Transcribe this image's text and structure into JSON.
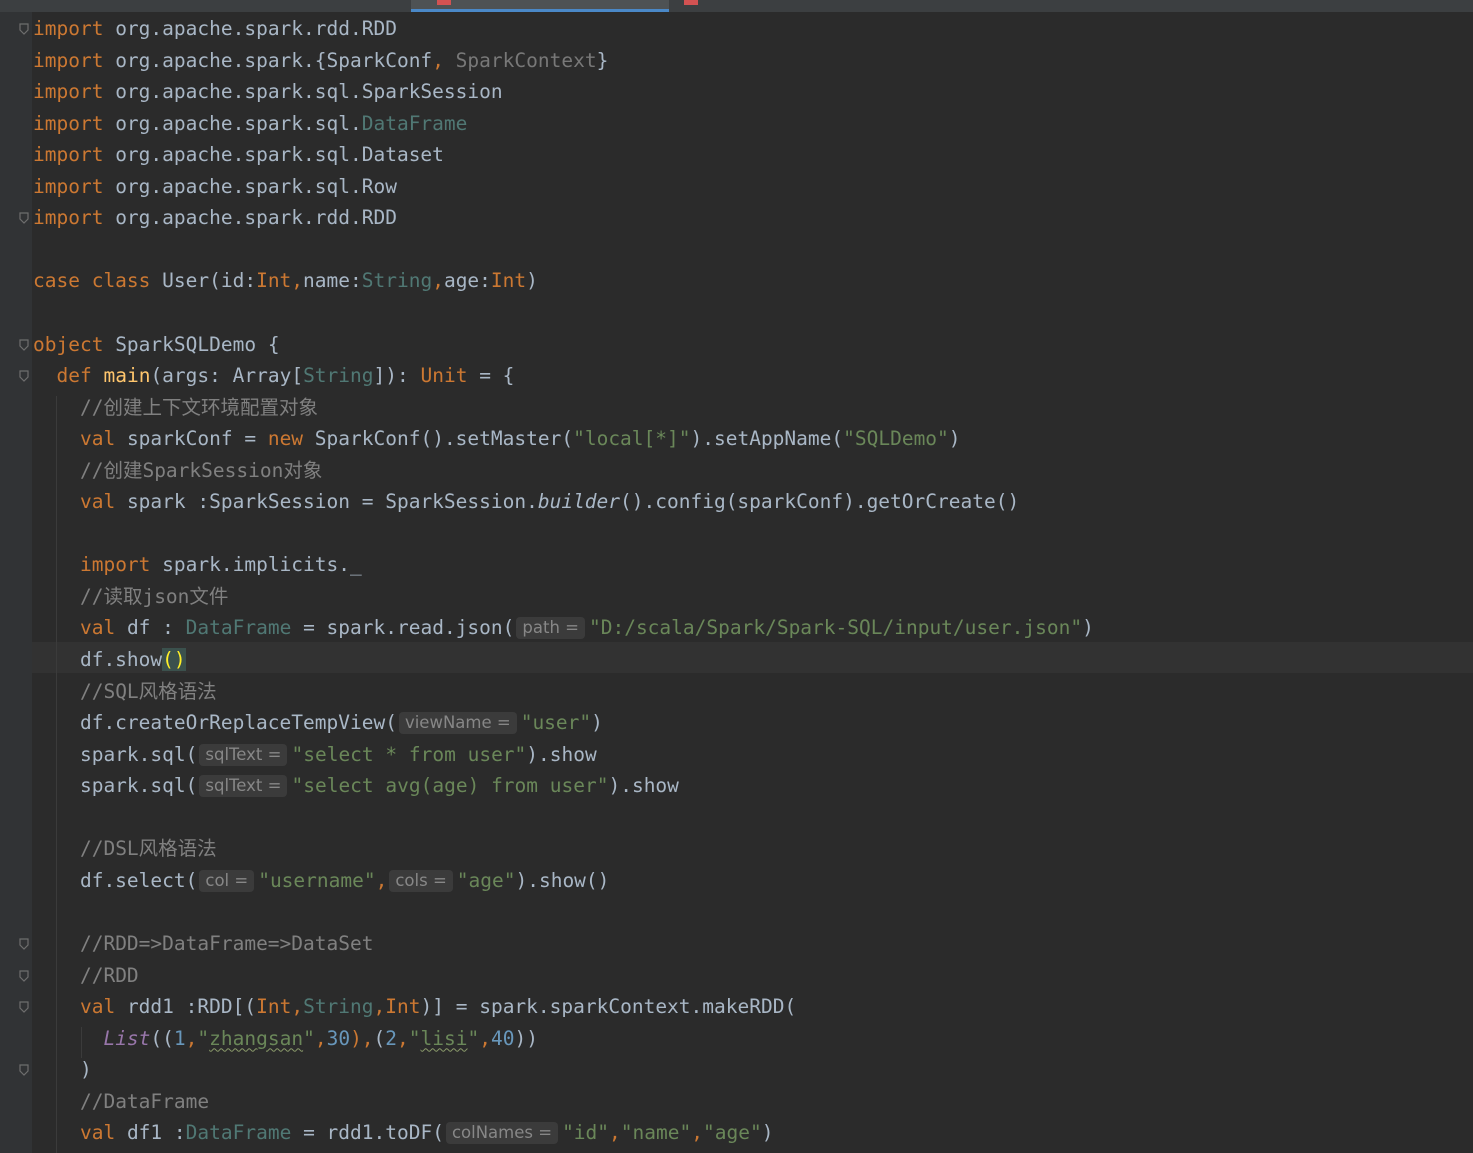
{
  "editor": {
    "lines": [
      [
        {
          "t": "import",
          "c": "kw"
        },
        {
          "t": " org.apache.spark.rdd.RDD"
        }
      ],
      [
        {
          "t": "import",
          "c": "kw"
        },
        {
          "t": " org.apache.spark.{SparkConf"
        },
        {
          "t": ",",
          "c": "kw"
        },
        {
          "t": " SparkContext",
          "c": "dim"
        },
        {
          "t": "}"
        }
      ],
      [
        {
          "t": "import",
          "c": "kw"
        },
        {
          "t": " org.apache.spark.sql.SparkSession"
        }
      ],
      [
        {
          "t": "import",
          "c": "kw"
        },
        {
          "t": " org.apache.spark.sql."
        },
        {
          "t": "DataFrame",
          "c": "ty"
        }
      ],
      [
        {
          "t": "import",
          "c": "kw"
        },
        {
          "t": " org.apache.spark.sql.Dataset"
        }
      ],
      [
        {
          "t": "import",
          "c": "kw"
        },
        {
          "t": " org.apache.spark.sql.Row"
        }
      ],
      [
        {
          "t": "import",
          "c": "kw"
        },
        {
          "t": " org.apache.spark.rdd.RDD"
        }
      ],
      [],
      [
        {
          "t": "case class",
          "c": "kw"
        },
        {
          "t": " User(id:"
        },
        {
          "t": "Int,",
          "c": "kw"
        },
        {
          "t": "name:"
        },
        {
          "t": "String",
          "c": "ty"
        },
        {
          "t": ",",
          "c": "kw"
        },
        {
          "t": "age:"
        },
        {
          "t": "Int",
          "c": "kw"
        },
        {
          "t": ")"
        }
      ],
      [],
      [
        {
          "t": "object",
          "c": "kw"
        },
        {
          "t": " SparkSQLDemo {"
        }
      ],
      [
        {
          "t": "  "
        },
        {
          "t": "def",
          "c": "kw"
        },
        {
          "t": " "
        },
        {
          "t": "main",
          "c": "fn"
        },
        {
          "t": "(args: Array["
        },
        {
          "t": "String",
          "c": "ty"
        },
        {
          "t": "]): "
        },
        {
          "t": "Unit",
          "c": "kw"
        },
        {
          "t": " = {"
        }
      ],
      [
        {
          "t": "    "
        },
        {
          "t": "//创建上下文环境配置对象",
          "c": "cm"
        }
      ],
      [
        {
          "t": "    "
        },
        {
          "t": "val",
          "c": "kw"
        },
        {
          "t": " sparkConf = "
        },
        {
          "t": "new",
          "c": "kw"
        },
        {
          "t": " SparkConf().setMaster("
        },
        {
          "t": "\"local[*]\"",
          "c": "str"
        },
        {
          "t": ").setAppName("
        },
        {
          "t": "\"SQLDemo\"",
          "c": "str"
        },
        {
          "t": ")"
        }
      ],
      [
        {
          "t": "    "
        },
        {
          "t": "//创建SparkSession对象",
          "c": "cm"
        }
      ],
      [
        {
          "t": "    "
        },
        {
          "t": "val",
          "c": "kw"
        },
        {
          "t": " spark :SparkSession = SparkSession."
        },
        {
          "t": "builder",
          "c": "it"
        },
        {
          "t": "().config(sparkConf).getOrCreate()"
        }
      ],
      [],
      [
        {
          "t": "    "
        },
        {
          "t": "import",
          "c": "kw"
        },
        {
          "t": " spark.implicits._"
        }
      ],
      [
        {
          "t": "    "
        },
        {
          "t": "//读取json文件",
          "c": "cm"
        }
      ],
      [
        {
          "t": "    "
        },
        {
          "t": "val",
          "c": "kw"
        },
        {
          "t": " df : "
        },
        {
          "t": "DataFrame",
          "c": "ty"
        },
        {
          "t": " = spark.read.json("
        },
        {
          "h": "path ="
        },
        {
          "t": "\"D:/scala/Spark/Spark-SQL/input/user.json\"",
          "c": "str"
        },
        {
          "t": ")"
        }
      ],
      [
        {
          "t": "    df.show"
        },
        {
          "t": "()",
          "c": "brace-hl"
        }
      ],
      [
        {
          "t": "    "
        },
        {
          "t": "//SQL风格语法",
          "c": "cm"
        }
      ],
      [
        {
          "t": "    df.createOrReplaceTempView("
        },
        {
          "h": "viewName ="
        },
        {
          "t": "\"user\"",
          "c": "str"
        },
        {
          "t": ")"
        }
      ],
      [
        {
          "t": "    spark.sql("
        },
        {
          "h": "sqlText ="
        },
        {
          "t": "\"select * from user\"",
          "c": "str"
        },
        {
          "t": ").show"
        }
      ],
      [
        {
          "t": "    spark.sql("
        },
        {
          "h": "sqlText ="
        },
        {
          "t": "\"select avg(age) from user\"",
          "c": "str"
        },
        {
          "t": ").show"
        }
      ],
      [],
      [
        {
          "t": "    "
        },
        {
          "t": "//DSL风格语法",
          "c": "cm"
        }
      ],
      [
        {
          "t": "    df.select("
        },
        {
          "h": "col ="
        },
        {
          "t": "\"username\"",
          "c": "str"
        },
        {
          "t": ",",
          "c": "kw"
        },
        {
          "h": "cols ="
        },
        {
          "t": "\"age\"",
          "c": "str"
        },
        {
          "t": ").show()"
        }
      ],
      [],
      [
        {
          "t": "    "
        },
        {
          "t": "//RDD=>DataFrame=>DataSet",
          "c": "cm"
        }
      ],
      [
        {
          "t": "    "
        },
        {
          "t": "//RDD",
          "c": "cm"
        }
      ],
      [
        {
          "t": "    "
        },
        {
          "t": "val",
          "c": "kw"
        },
        {
          "t": " rdd1 :RDD[("
        },
        {
          "t": "Int",
          "c": "kw"
        },
        {
          "t": ",",
          "c": "kw"
        },
        {
          "t": "String",
          "c": "ty"
        },
        {
          "t": ",",
          "c": "kw"
        },
        {
          "t": "Int",
          "c": "kw"
        },
        {
          "t": ")] = spark.sparkContext.makeRDD("
        }
      ],
      [
        {
          "t": "      "
        },
        {
          "t": "List",
          "c": "itp"
        },
        {
          "t": "(("
        },
        {
          "t": "1",
          "c": "num"
        },
        {
          "t": ",",
          "c": "kw"
        },
        {
          "t": "\"",
          "c": "str"
        },
        {
          "t": "zhangsan",
          "c": "str typo"
        },
        {
          "t": "\"",
          "c": "str"
        },
        {
          "t": ",",
          "c": "kw"
        },
        {
          "t": "30",
          "c": "num"
        },
        {
          "t": "),",
          "c": "kw"
        },
        {
          "t": "("
        },
        {
          "t": "2",
          "c": "num"
        },
        {
          "t": ",",
          "c": "kw"
        },
        {
          "t": "\"",
          "c": "str"
        },
        {
          "t": "lisi",
          "c": "str typo"
        },
        {
          "t": "\"",
          "c": "str"
        },
        {
          "t": ",",
          "c": "kw"
        },
        {
          "t": "40",
          "c": "num"
        },
        {
          "t": "))"
        }
      ],
      [
        {
          "t": "    )"
        }
      ],
      [
        {
          "t": "    "
        },
        {
          "t": "//DataFrame",
          "c": "cm"
        }
      ],
      [
        {
          "t": "    "
        },
        {
          "t": "val",
          "c": "kw"
        },
        {
          "t": " df1 :"
        },
        {
          "t": "DataFrame",
          "c": "ty"
        },
        {
          "t": " = rdd1.toDF("
        },
        {
          "h": "colNames ="
        },
        {
          "t": "\"id\"",
          "c": "str"
        },
        {
          "t": ",",
          "c": "kw"
        },
        {
          "t": "\"name\"",
          "c": "str"
        },
        {
          "t": ",",
          "c": "kw"
        },
        {
          "t": "\"age\"",
          "c": "str"
        },
        {
          "t": ")"
        }
      ]
    ]
  },
  "colors": {
    "background": "#2b2b2b",
    "keyword": "#cc7832",
    "string": "#6a8759",
    "comment": "#808080",
    "number": "#6897bb",
    "function": "#ffc66d"
  }
}
